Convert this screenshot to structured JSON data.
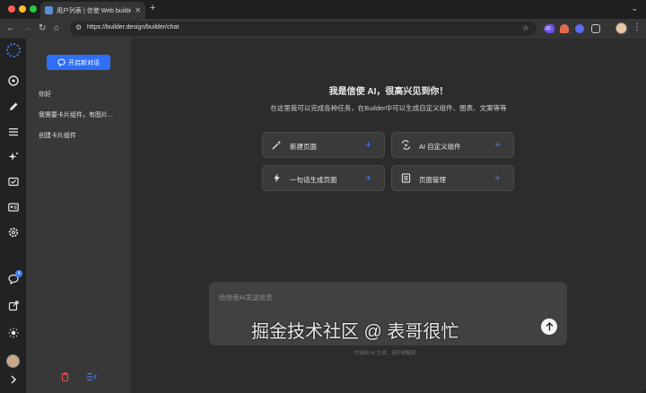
{
  "browser": {
    "tab_title": "用户列表 | 信使 Web builder",
    "url": "https://builder.design/builder/chat",
    "extension_badge": "16"
  },
  "rail": {
    "notification_count": "4"
  },
  "sidebar": {
    "new_chat_label": "开启新对话",
    "history": [
      "你好",
      "我需要卡片组件，有图片...",
      "创建卡片组件"
    ]
  },
  "main": {
    "greeting": "我是信使 AI，很高兴见到你！",
    "subtitle": "在这里我可以完成各种任务，在Builder中可以生成自定义组件、图表、文案等等",
    "cards": [
      {
        "label": "新建页面",
        "icon": "magic-wand-icon"
      },
      {
        "label": "AI 自定义组件",
        "icon": "ai-component-icon"
      },
      {
        "label": "一句话生成页面",
        "icon": "lightning-icon"
      },
      {
        "label": "页面管理",
        "icon": "page-list-icon"
      }
    ],
    "input_placeholder": "给信使AI发送信息",
    "disclaimer": "内容由 AI 生成，请仔细甄别"
  },
  "watermark": "掘金技术社区 @ 表哥很忙",
  "colors": {
    "accent": "#2f6ef5",
    "background": "#2c2c2c",
    "sidebar": "#383838"
  }
}
